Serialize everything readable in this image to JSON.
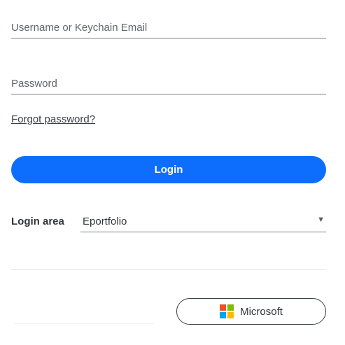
{
  "login_form": {
    "username": {
      "placeholder": "Username or Keychain Email",
      "value": ""
    },
    "password": {
      "placeholder": "Password",
      "value": ""
    },
    "forgot_password_label": "Forgot password?",
    "login_button_label": "Login",
    "login_area": {
      "label": "Login area",
      "selected": "Eportfolio",
      "arrow_icon": "triangle-down-icon"
    }
  },
  "external_login": {
    "microsoft_label": "Microsoft",
    "microsoft_icon": "microsoft-logo-icon",
    "microsoft_colors": [
      "#f25022",
      "#7fba00",
      "#00a4ef",
      "#ffb900"
    ]
  },
  "colors": {
    "primary": "#0d6efd",
    "text": "#333a40",
    "underline": "#7a7f85"
  }
}
